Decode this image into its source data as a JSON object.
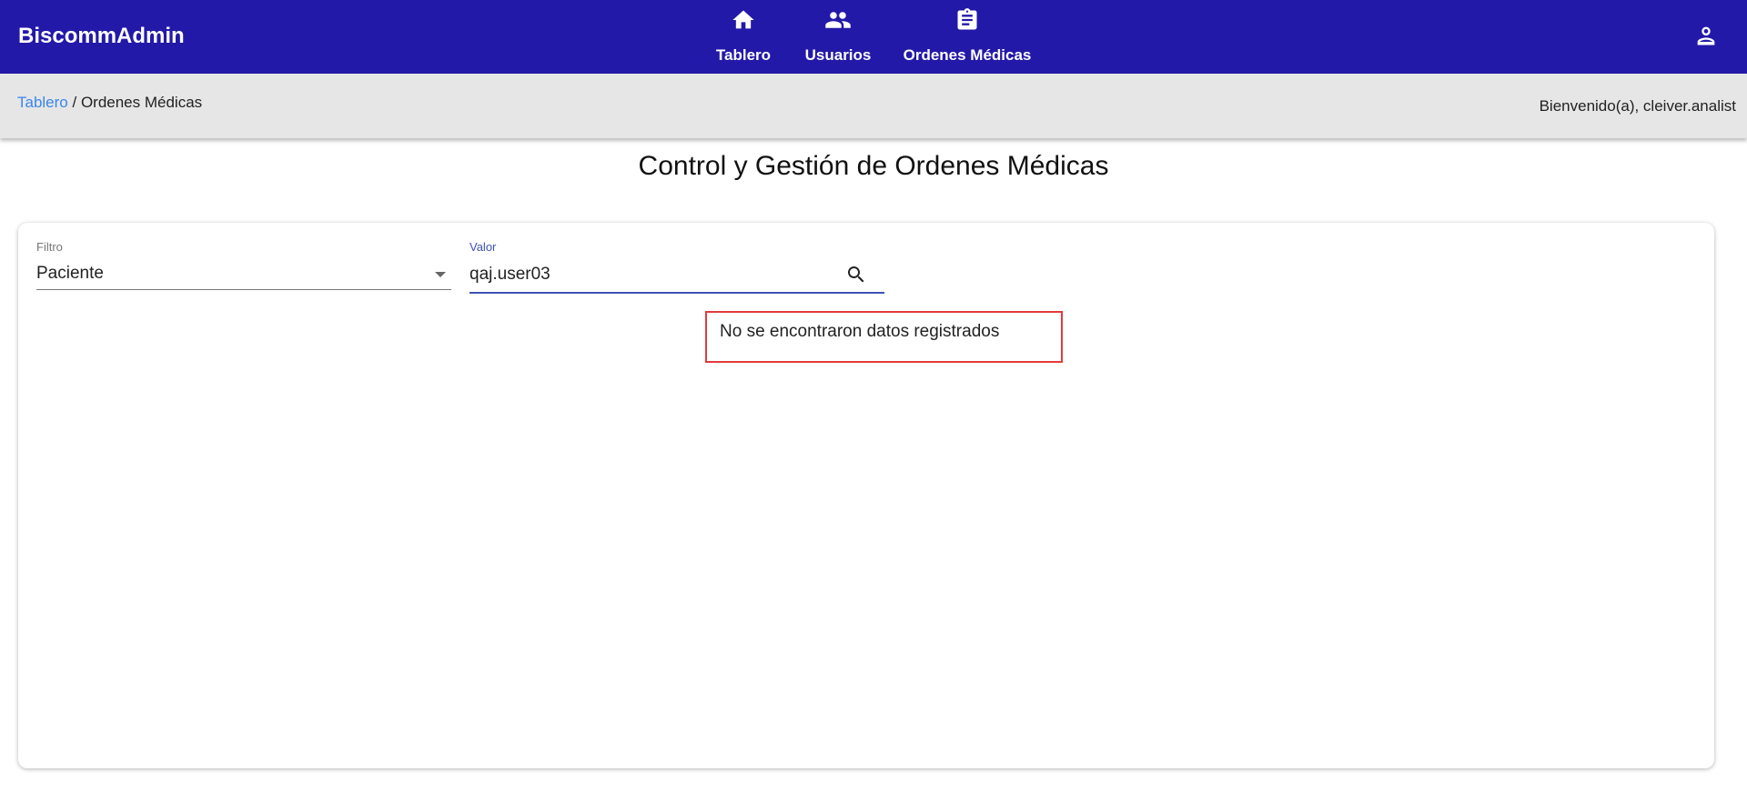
{
  "header": {
    "brand": "BiscommAdmin",
    "nav": [
      {
        "label": "Tablero",
        "icon": "home-icon"
      },
      {
        "label": "Usuarios",
        "icon": "people-icon"
      },
      {
        "label": "Ordenes Médicas",
        "icon": "clipboard-icon"
      }
    ],
    "account_icon": "account-icon"
  },
  "breadcrumb": {
    "link": "Tablero",
    "separator": " / ",
    "current": "Ordenes Médicas"
  },
  "welcome": "Bienvenido(a), cleiver.analist",
  "page_title": "Control y Gestión de Ordenes Médicas",
  "filters": {
    "filter_label": "Filtro",
    "filter_value": "Paciente",
    "value_label": "Valor",
    "value_input": "qaj.user03",
    "search_icon": "search-icon"
  },
  "empty_message": "No se encontraron datos registrados",
  "colors": {
    "header_bg": "#2319a8",
    "subbar_bg": "#e6e6e6",
    "link": "#3a86e8",
    "accent": "#3f51b5",
    "highlight_border": "#e23b3b"
  }
}
